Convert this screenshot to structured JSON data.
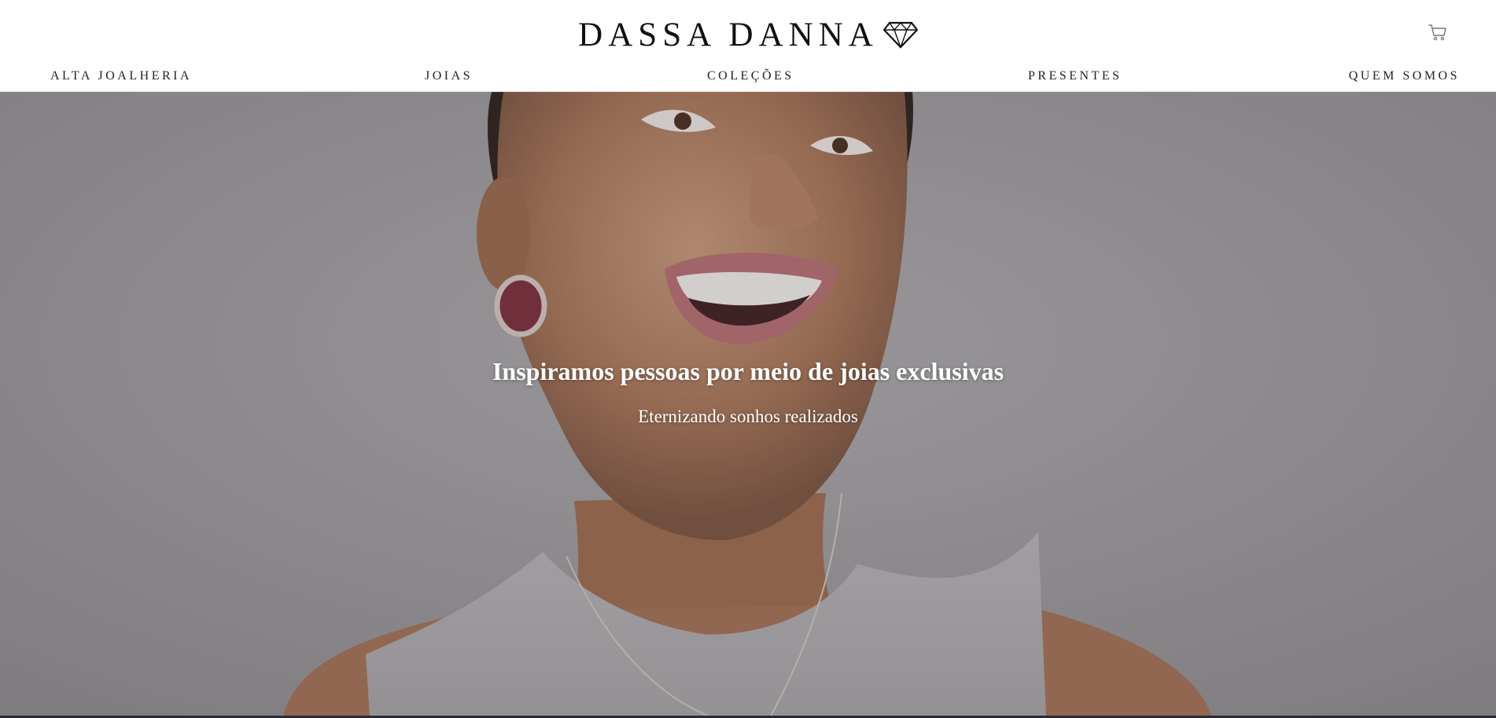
{
  "brand": {
    "name": "DASSA DANNA",
    "logo_icon": "diamond-icon"
  },
  "header": {
    "cart_icon": "cart-icon"
  },
  "nav": {
    "items": [
      {
        "label": "ALTA JOALHERIA"
      },
      {
        "label": "JOIAS"
      },
      {
        "label": "COLEÇÕES"
      },
      {
        "label": "PRESENTES"
      },
      {
        "label": "QUEM SOMOS"
      }
    ]
  },
  "hero": {
    "title": "Inspiramos pessoas por meio de joias exclusivas",
    "subtitle": "Eternizando sonhos realizados"
  },
  "colors": {
    "header_bg": "#ffffff",
    "text_dark": "#222222",
    "hero_bg": "#9c9a9c",
    "hero_text": "#ffffff"
  }
}
